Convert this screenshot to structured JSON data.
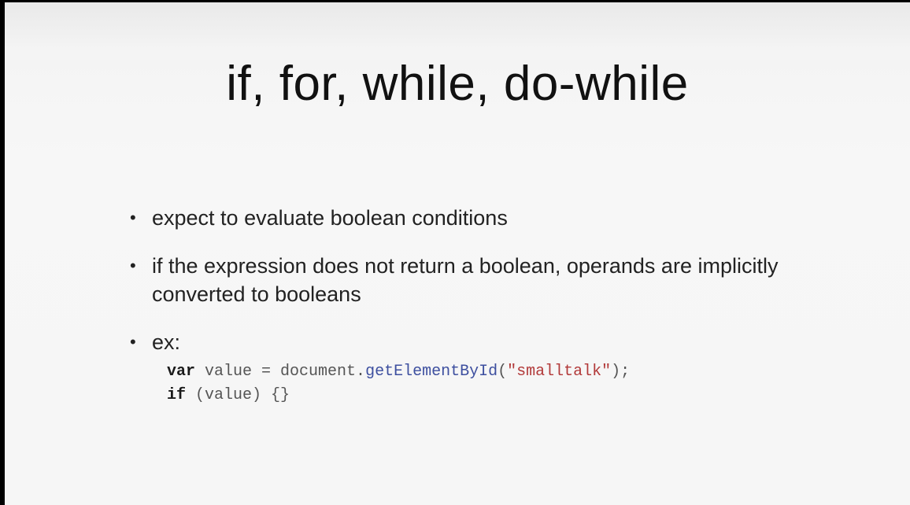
{
  "slide": {
    "title": "if, for, while, do-while",
    "bullets": [
      "expect to evaluate boolean conditions",
      "if the expression does not return a boolean, operands are implicitly converted to booleans",
      "ex:"
    ],
    "bullet_glyph": "•",
    "code": {
      "line1": {
        "keyword": "var",
        "pre": " value = document.",
        "method": "getElementById",
        "open": "(",
        "string": "\"smalltalk\"",
        "close": ");"
      },
      "line2": {
        "keyword": "if",
        "rest": " (value) {}"
      }
    }
  },
  "colors": {
    "keyword": "#1a1a1a",
    "method": "#3d4f9f",
    "string": "#b23a3a",
    "code_text": "#555555"
  }
}
